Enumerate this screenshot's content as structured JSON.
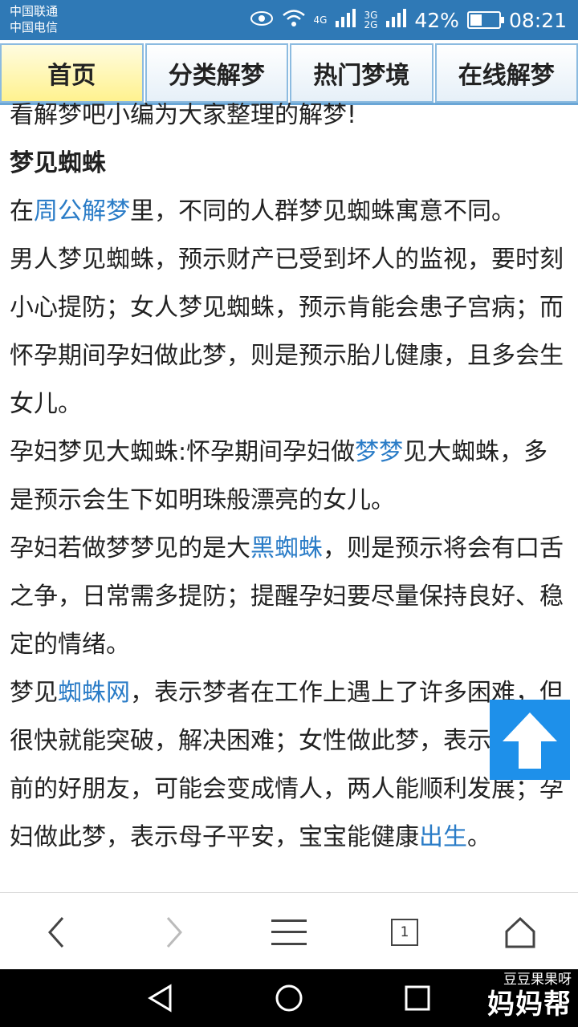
{
  "status_bar": {
    "carrier_1": "中国联通",
    "carrier_2": "中国电信",
    "net_4g": "4G",
    "net_3g": "3G",
    "net_2g": "2G",
    "battery": "42%",
    "battery_level": 0.42,
    "time": "08:21"
  },
  "nav": {
    "tabs": [
      {
        "label": "首页",
        "active": true
      },
      {
        "label": "分类解梦",
        "active": false
      },
      {
        "label": "热门梦境",
        "active": false
      },
      {
        "label": "在线解梦",
        "active": false
      }
    ]
  },
  "article": {
    "intro": "看解梦吧小编为大家整理的解梦!",
    "heading": "梦见蜘蛛",
    "p1": {
      "pre": "在",
      "link": "周公解梦",
      "post": "里，不同的人群梦见蜘蛛寓意不同。"
    },
    "p2": "男人梦见蜘蛛，预示财产已受到坏人的监视，要时刻小心提防；女人梦见蜘蛛，预示肯能会患子宫病；而怀孕期间孕妇做此梦，则是预示胎儿健康，且多会生女儿。",
    "p3": {
      "pre": "孕妇梦见大蜘蛛:怀孕期间孕妇做",
      "link": "梦梦",
      "post": "见大蜘蛛，多是预示会生下如明珠般漂亮的女儿。"
    },
    "p4": {
      "pre": "孕妇若做梦梦见的是大",
      "link": "黑蜘蛛",
      "post": "，则是预示将会有口舌之争，日常需多提防；提醒孕妇要尽量保持良好、稳定的情绪。"
    },
    "p5": {
      "pre": "梦见",
      "link": "蜘蛛网",
      "mid": "，表示梦者在工作上遇上了许多困难，但很快就能突破，解决困难；女性做此梦，表示梦者以前的好朋友，可能会变成情人，两人能顺利发展；孕妇做此梦，表示母子平安，宝宝能健康",
      "link2": "出生",
      "post": "。"
    }
  },
  "toolbar": {
    "tab_count": "1"
  },
  "watermark": {
    "top": "豆豆果果呀",
    "main": "妈妈帮"
  },
  "colors": {
    "status_bar": "#2f79b6",
    "link": "#2a7cc7",
    "active_tab": "#fff28f",
    "scroll_top_button": "#1e90ea"
  },
  "icons": [
    "eye-icon",
    "wifi-icon",
    "signal-icon",
    "battery-icon",
    "arrow-up-icon",
    "back-icon",
    "forward-icon",
    "menu-icon",
    "tabs-icon",
    "home-icon",
    "sys-back-icon",
    "sys-home-icon",
    "sys-recent-icon"
  ]
}
